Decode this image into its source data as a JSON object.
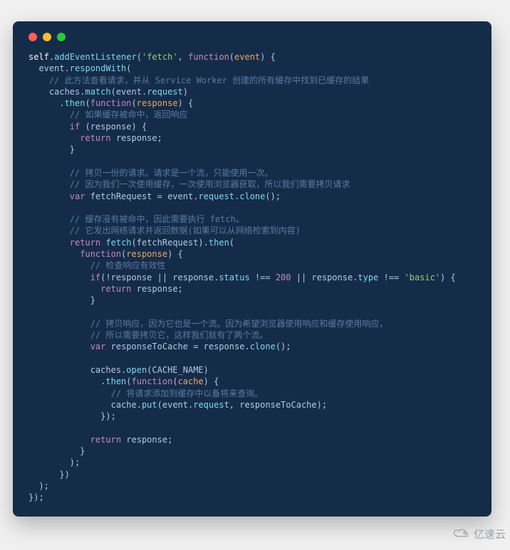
{
  "watermark_text": "亿速云",
  "code": {
    "l1": {
      "a": "self",
      "b": ".",
      "c": "addEventListener",
      "d": "(",
      "e": "'fetch'",
      "f": ", ",
      "g": "function",
      "h": "(",
      "i": "event",
      "j": ") {"
    },
    "l2": {
      "a": "  event.",
      "b": "respondWith",
      "c": "("
    },
    "l3": {
      "a": "    // 此方法查看请求，并从 Service Worker 创建的所有缓存中找到已缓存的结果"
    },
    "l4": {
      "a": "    caches.",
      "b": "match",
      "c": "(event.",
      "d": "request",
      "e": ")"
    },
    "l5": {
      "a": "      .",
      "b": "then",
      "c": "(",
      "d": "function",
      "e": "(",
      "f": "response",
      "g": ") {"
    },
    "l6": {
      "a": "        // 如果缓存被命中，返回响应"
    },
    "l7": {
      "a": "        ",
      "b": "if",
      "c": " (response) {"
    },
    "l8": {
      "a": "          ",
      "b": "return",
      "c": " response;"
    },
    "l9": {
      "a": "        }"
    },
    "l10": {
      "a": ""
    },
    "l11": {
      "a": "        // 拷贝一份的请求。请求是一个流，只能使用一次。"
    },
    "l12": {
      "a": "        // 因为我们一次使用缓存，一次使用浏览器获取，所以我们需要拷贝请求"
    },
    "l13": {
      "a": "        ",
      "b": "var",
      "c": " fetchRequest = event.",
      "d": "request",
      "e": ".",
      "f": "clone",
      "g": "();"
    },
    "l14": {
      "a": ""
    },
    "l15": {
      "a": "        // 缓存没有被命中，因此需要执行 fetch。"
    },
    "l16": {
      "a": "        // 它发出网络请求并返回数据(如果可以从网络检索到内容)"
    },
    "l17": {
      "a": "        ",
      "b": "return",
      "c": " ",
      "d": "fetch",
      "e": "(fetchRequest).",
      "f": "then",
      "g": "("
    },
    "l18": {
      "a": "          ",
      "b": "function",
      "c": "(",
      "d": "response",
      "e": ") {"
    },
    "l19": {
      "a": "            // 检查响应有效性"
    },
    "l20": {
      "a": "            ",
      "b": "if",
      "c": "(!response || response.",
      "d": "status",
      "e": " !== ",
      "f": "200",
      "g": " || response.",
      "h": "type",
      "i": " !== ",
      "j": "'basic'",
      "k": ") {"
    },
    "l21": {
      "a": "              ",
      "b": "return",
      "c": " response;"
    },
    "l22": {
      "a": "            }"
    },
    "l23": {
      "a": ""
    },
    "l24": {
      "a": "            // 拷贝响应，因为它也是一个流。因为希望浏览器使用响应和缓存使用响应，"
    },
    "l25": {
      "a": "            // 所以需要拷贝它，这样我们就有了两个流。"
    },
    "l26": {
      "a": "            ",
      "b": "var",
      "c": " responseToCache = response.",
      "d": "clone",
      "e": "();"
    },
    "l27": {
      "a": ""
    },
    "l28": {
      "a": "            caches.",
      "b": "open",
      "c": "(CACHE_NAME)"
    },
    "l29": {
      "a": "              .",
      "b": "then",
      "c": "(",
      "d": "function",
      "e": "(",
      "f": "cache",
      "g": ") {"
    },
    "l30": {
      "a": "                // 将请求添加到缓存中以备将来查询。"
    },
    "l31": {
      "a": "                cache.",
      "b": "put",
      "c": "(event.",
      "d": "request",
      "e": ", responseToCache);"
    },
    "l32": {
      "a": "              });"
    },
    "l33": {
      "a": ""
    },
    "l34": {
      "a": "            ",
      "b": "return",
      "c": " response;"
    },
    "l35": {
      "a": "          }"
    },
    "l36": {
      "a": "        );"
    },
    "l37": {
      "a": "      })"
    },
    "l38": {
      "a": "  );"
    },
    "l39": {
      "a": "});"
    }
  }
}
